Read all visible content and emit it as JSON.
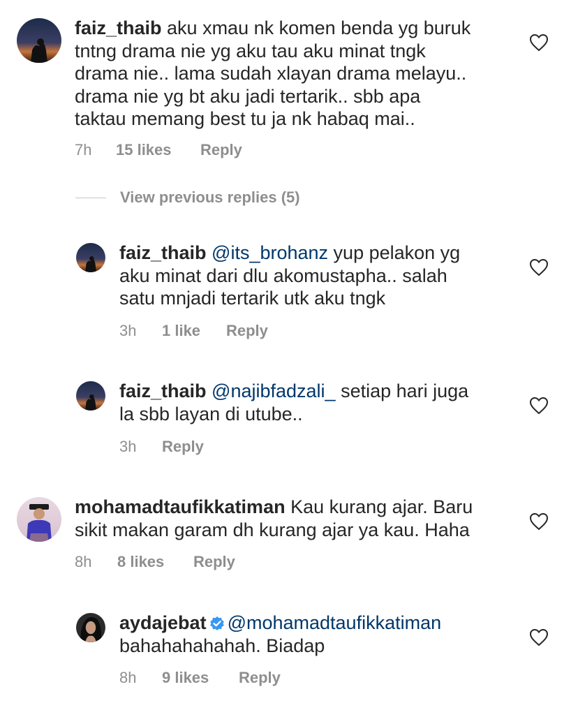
{
  "colors": {
    "text": "#262626",
    "secondary": "#8e8e8e",
    "mention": "#00376b",
    "verified": "#3897f0"
  },
  "comments": [
    {
      "username": "faiz_thaib",
      "text": " aku xmau nk komen benda yg buruk\ntntng drama nie yg aku tau aku minat tngk\ndrama nie.. lama sudah xlayan drama melayu..\ndrama nie yg bt aku jadi tertarik.. sbb apa\ntaktau memang best tu ja nk habaq mai..",
      "time": "7h",
      "likes": "15 likes",
      "reply": "Reply"
    },
    {
      "username": "faiz_thaib",
      "mention": "@its_brohanz",
      "text": " yup pelakon yg\naku minat dari dlu akomustapha.. salah\nsatu mnjadi tertarik utk aku tngk",
      "time": "3h",
      "likes": "1 like",
      "reply": "Reply"
    },
    {
      "username": "faiz_thaib",
      "mention": "@najibfadzali_",
      "text": " setiap hari juga\nla sbb layan di utube..",
      "time": "3h",
      "reply": "Reply"
    },
    {
      "username": "mohamadtaufikkatiman",
      "text": " Kau kurang ajar. Baru\nsikit makan garam dh kurang ajar ya kau. Haha",
      "time": "8h",
      "likes": "8 likes",
      "reply": "Reply"
    },
    {
      "username": "aydajebat",
      "mention": "@mohamadtaufikkatiman",
      "text": "\nbahahahahahah. Biadap",
      "time": "8h",
      "likes": "9 likes",
      "reply": "Reply"
    }
  ],
  "view_previous": "View previous replies (5)"
}
